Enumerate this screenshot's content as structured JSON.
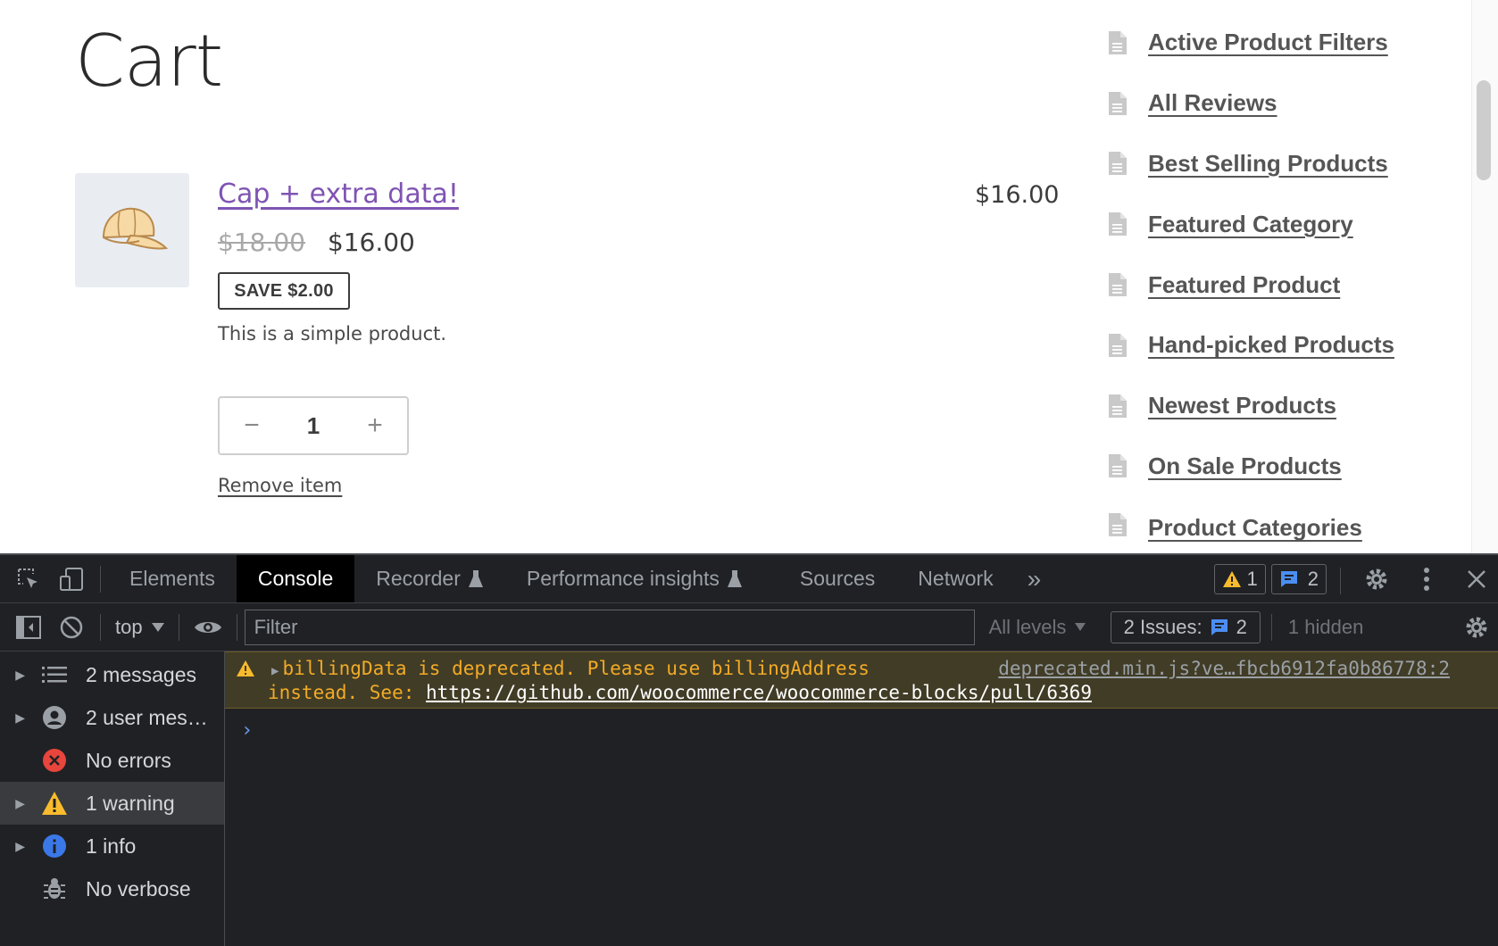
{
  "page": {
    "title": "Cart",
    "product": {
      "name": "Cap + extra data!",
      "regular_price": "$18.00",
      "sale_price": "$16.00",
      "save_badge": "SAVE $2.00",
      "description": "This is a simple product.",
      "quantity": "1",
      "decrement": "−",
      "increment": "+",
      "remove_label": "Remove item",
      "line_total": "$16.00"
    },
    "sidebar": {
      "items": [
        {
          "label": "Active Product Filters"
        },
        {
          "label": "All Reviews"
        },
        {
          "label": "Best Selling Products"
        },
        {
          "label": "Featured Category"
        },
        {
          "label": "Featured Product"
        },
        {
          "label": "Hand-picked Products"
        },
        {
          "label": "Newest Products"
        },
        {
          "label": "On Sale Products"
        },
        {
          "label": "Product Categories List"
        }
      ]
    }
  },
  "devtools": {
    "tabs": [
      {
        "label": "Elements"
      },
      {
        "label": "Console",
        "active": true
      },
      {
        "label": "Recorder"
      },
      {
        "label": "Performance insights"
      },
      {
        "label": "Sources"
      },
      {
        "label": "Network"
      }
    ],
    "more_tabs": "»",
    "warning_count": "1",
    "info_count": "2",
    "toolbar": {
      "context": "top",
      "filter_placeholder": "Filter",
      "levels": "All levels",
      "issues_label": "2 Issues:",
      "issues_count": "2",
      "hidden": "1 hidden"
    },
    "sidebar": [
      {
        "label": "2 messages",
        "icon": "list-icon"
      },
      {
        "label": "2 user mes…",
        "icon": "user-icon"
      },
      {
        "label": "No errors",
        "icon": "error-icon"
      },
      {
        "label": "1 warning",
        "icon": "warning-icon"
      },
      {
        "label": "1 info",
        "icon": "info-icon"
      },
      {
        "label": "No verbose",
        "icon": "bug-icon"
      }
    ],
    "console": {
      "warning_line1": "billingData is deprecated. Please use billingAddress",
      "warning_line2_prefix": "instead. See: ",
      "warning_link": "https://github.com/woocommerce/woocommerce-blocks/pull/6369",
      "warning_source": "deprecated.min.js?ve…fbcb6912fa0b86778:2",
      "prompt": "›"
    }
  }
}
